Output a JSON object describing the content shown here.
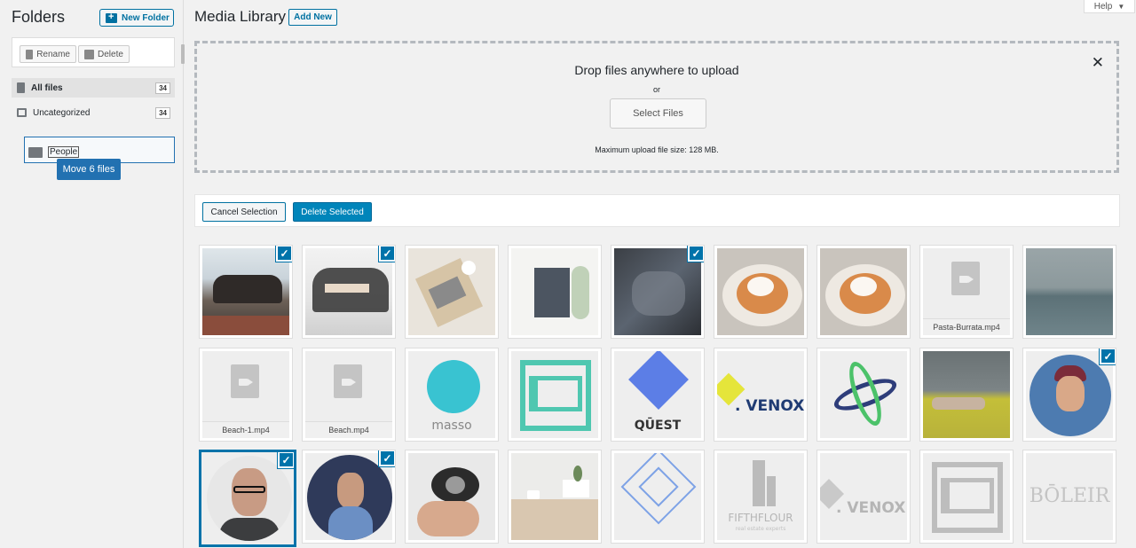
{
  "sidebar": {
    "title": "Folders",
    "new_folder_label": "New Folder",
    "rename_label": "Rename",
    "delete_label": "Delete",
    "folders": [
      {
        "label": "All files",
        "count": "34"
      },
      {
        "label": "Uncategorized",
        "count": "34"
      }
    ],
    "drop_target_label": "People",
    "drag_tooltip": "Move 6 files"
  },
  "header": {
    "title": "Media Library",
    "add_new_label": "Add New",
    "help_label": "Help",
    "help_icon": "caret-down-icon"
  },
  "uploader": {
    "title": "Drop files anywhere to upload",
    "or_text": "or",
    "select_files_label": "Select Files",
    "max_size_text": "Maximum upload file size: 128 MB.",
    "close_icon": "✕"
  },
  "toolbar": {
    "cancel_label": "Cancel Selection",
    "delete_label": "Delete Selected"
  },
  "media": {
    "video_labels": [
      "Pasta-Burrata.mp4",
      "Beach-1.mp4",
      "Beach.mp4"
    ],
    "logo_texts": [
      "masso",
      "QŪEST",
      ". VENOX",
      "FIFTHFLOUR",
      "real estate experts",
      ". VENOX",
      "BŌLEIR"
    ],
    "selected_count": 6,
    "check_mark": "✓"
  }
}
